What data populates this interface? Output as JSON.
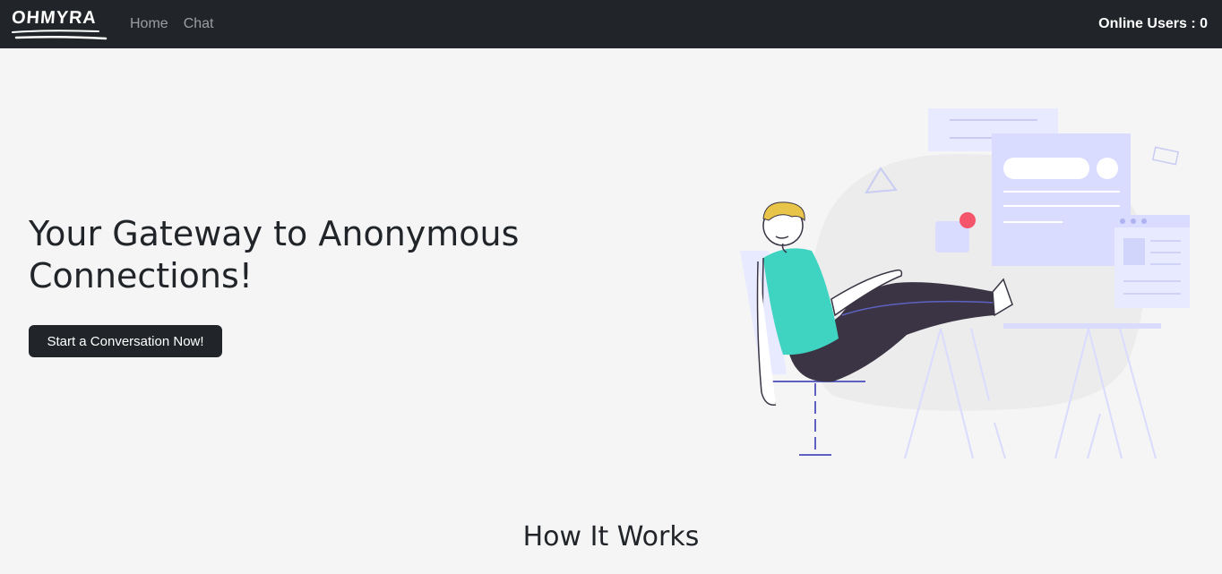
{
  "navbar": {
    "brand": "OHMYRA",
    "links": [
      {
        "label": "Home"
      },
      {
        "label": "Chat"
      }
    ],
    "online_users": "Online Users : 0"
  },
  "hero": {
    "title": "Your Gateway to Anonymous Connections!",
    "cta_label": "Start a Conversation Now!"
  },
  "how_it_works": {
    "title": "How It Works"
  },
  "colors": {
    "navbar_bg": "#212529",
    "page_bg": "#f5f5f5",
    "accent_teal": "#3fd4c2",
    "accent_pants": "#3a3444",
    "accent_hair": "#e8c548",
    "accent_red": "#f5556a",
    "illustration_lavender": "#dadcff"
  }
}
